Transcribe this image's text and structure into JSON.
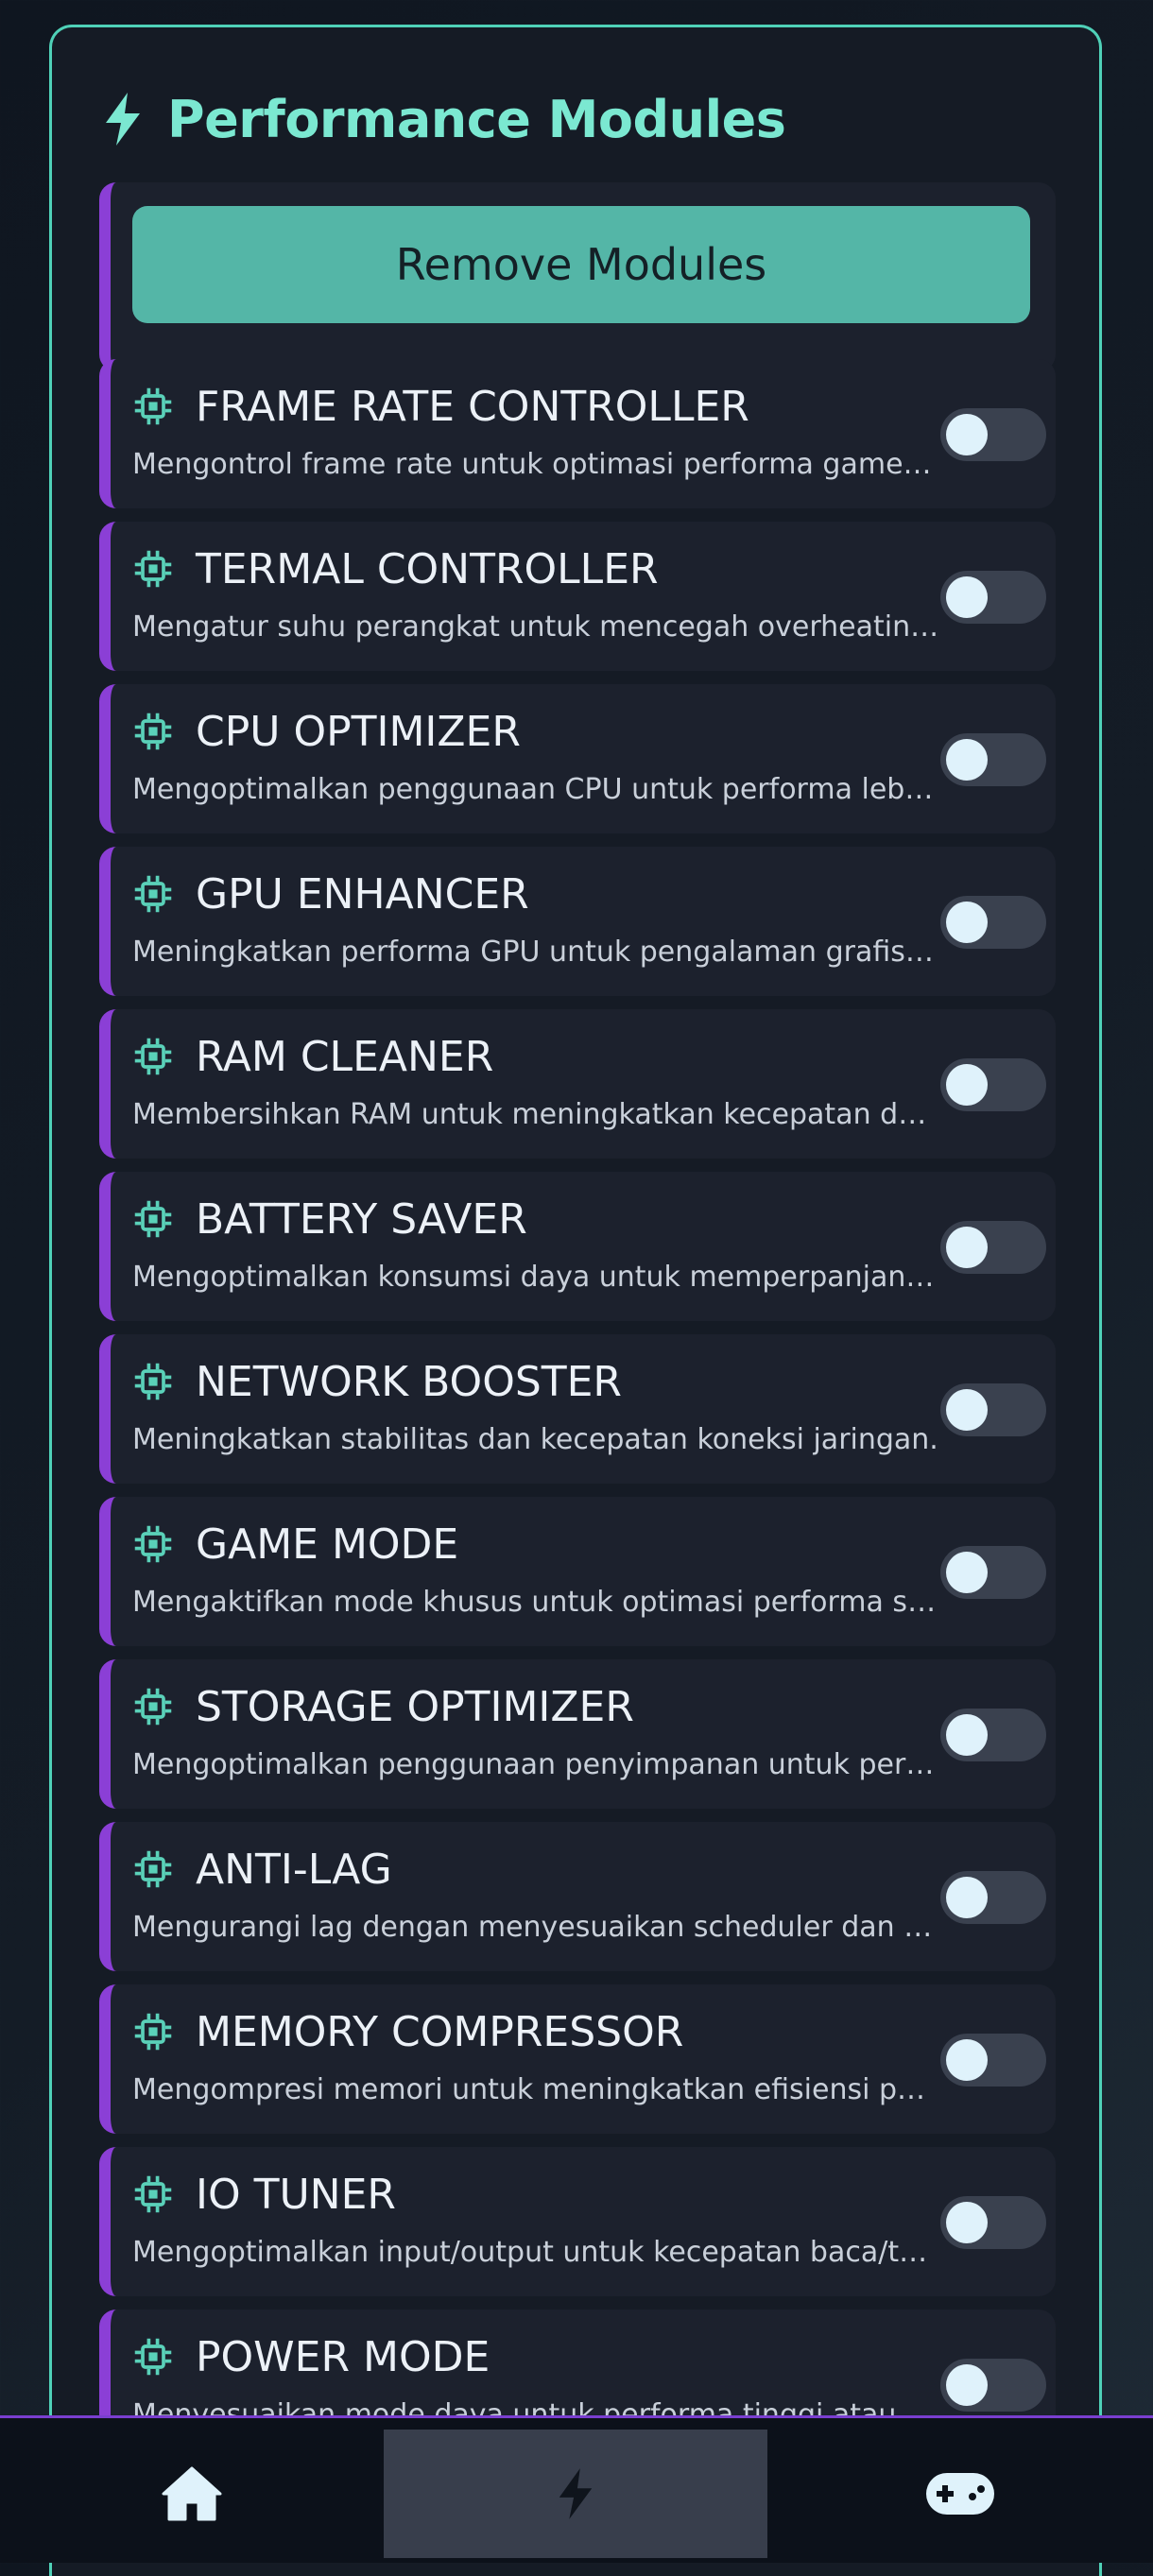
{
  "panel": {
    "title": "Performance Modules",
    "title_icon": "bolt-icon",
    "accent_color": "#4fd1b8",
    "card_accent_color": "#8b3fd6"
  },
  "remove_button": {
    "label": "Remove Modules"
  },
  "modules": [
    {
      "title": "FRAME RATE CONTROLLER",
      "description": "Mengontrol frame rate untuk optimasi performa game dan aplikasi.",
      "icon": "chip-icon",
      "enabled": false
    },
    {
      "title": "TERMAL CONTROLLER",
      "description": "Mengatur suhu perangkat untuk mencegah overheating saat digunakan.",
      "icon": "chip-icon",
      "enabled": false
    },
    {
      "title": "CPU OPTIMIZER",
      "description": "Mengoptimalkan penggunaan CPU untuk performa lebih maksimal.",
      "icon": "chip-icon",
      "enabled": false
    },
    {
      "title": "GPU ENHANCER",
      "description": "Meningkatkan performa GPU untuk pengalaman grafis yang lebih baik.",
      "icon": "chip-icon",
      "enabled": false
    },
    {
      "title": "RAM CLEANER",
      "description": "Membersihkan RAM untuk meningkatkan kecepatan dan responsivitas.",
      "icon": "chip-icon",
      "enabled": false
    },
    {
      "title": "BATTERY SAVER",
      "description": "Mengoptimalkan konsumsi daya untuk memperpanjang masa pakai baterai.",
      "icon": "chip-icon",
      "enabled": false
    },
    {
      "title": "NETWORK BOOSTER",
      "description": "Meningkatkan stabilitas dan kecepatan koneksi jaringan.",
      "icon": "chip-icon",
      "enabled": false
    },
    {
      "title": "GAME MODE",
      "description": "Mengaktifkan mode khusus untuk optimasi performa saat bermain game.",
      "icon": "chip-icon",
      "enabled": false
    },
    {
      "title": "STORAGE OPTIMIZER",
      "description": "Mengoptimalkan penggunaan penyimpanan untuk performa yang lebih baik.",
      "icon": "chip-icon",
      "enabled": false
    },
    {
      "title": "ANTI-LAG",
      "description": "Mengurangi lag dengan menyesuaikan scheduler dan prioritas proses.",
      "icon": "chip-icon",
      "enabled": false
    },
    {
      "title": "MEMORY COMPRESSOR",
      "description": "Mengompresi memori untuk meningkatkan efisiensi penggunaan RAM.",
      "icon": "chip-icon",
      "enabled": false
    },
    {
      "title": "IO TUNER",
      "description": "Mengoptimalkan input/output untuk kecepatan baca/tulis yang lebih cepat.",
      "icon": "chip-icon",
      "enabled": false
    },
    {
      "title": "POWER MODE",
      "description": "Menyesuaikan mode daya untuk performa tinggi atau hemat energi.",
      "icon": "chip-icon",
      "enabled": false
    }
  ],
  "bottom_nav": {
    "items": [
      {
        "icon": "home-icon",
        "active": false
      },
      {
        "icon": "bolt-icon",
        "active": true
      },
      {
        "icon": "gamepad-icon",
        "active": false
      }
    ]
  }
}
